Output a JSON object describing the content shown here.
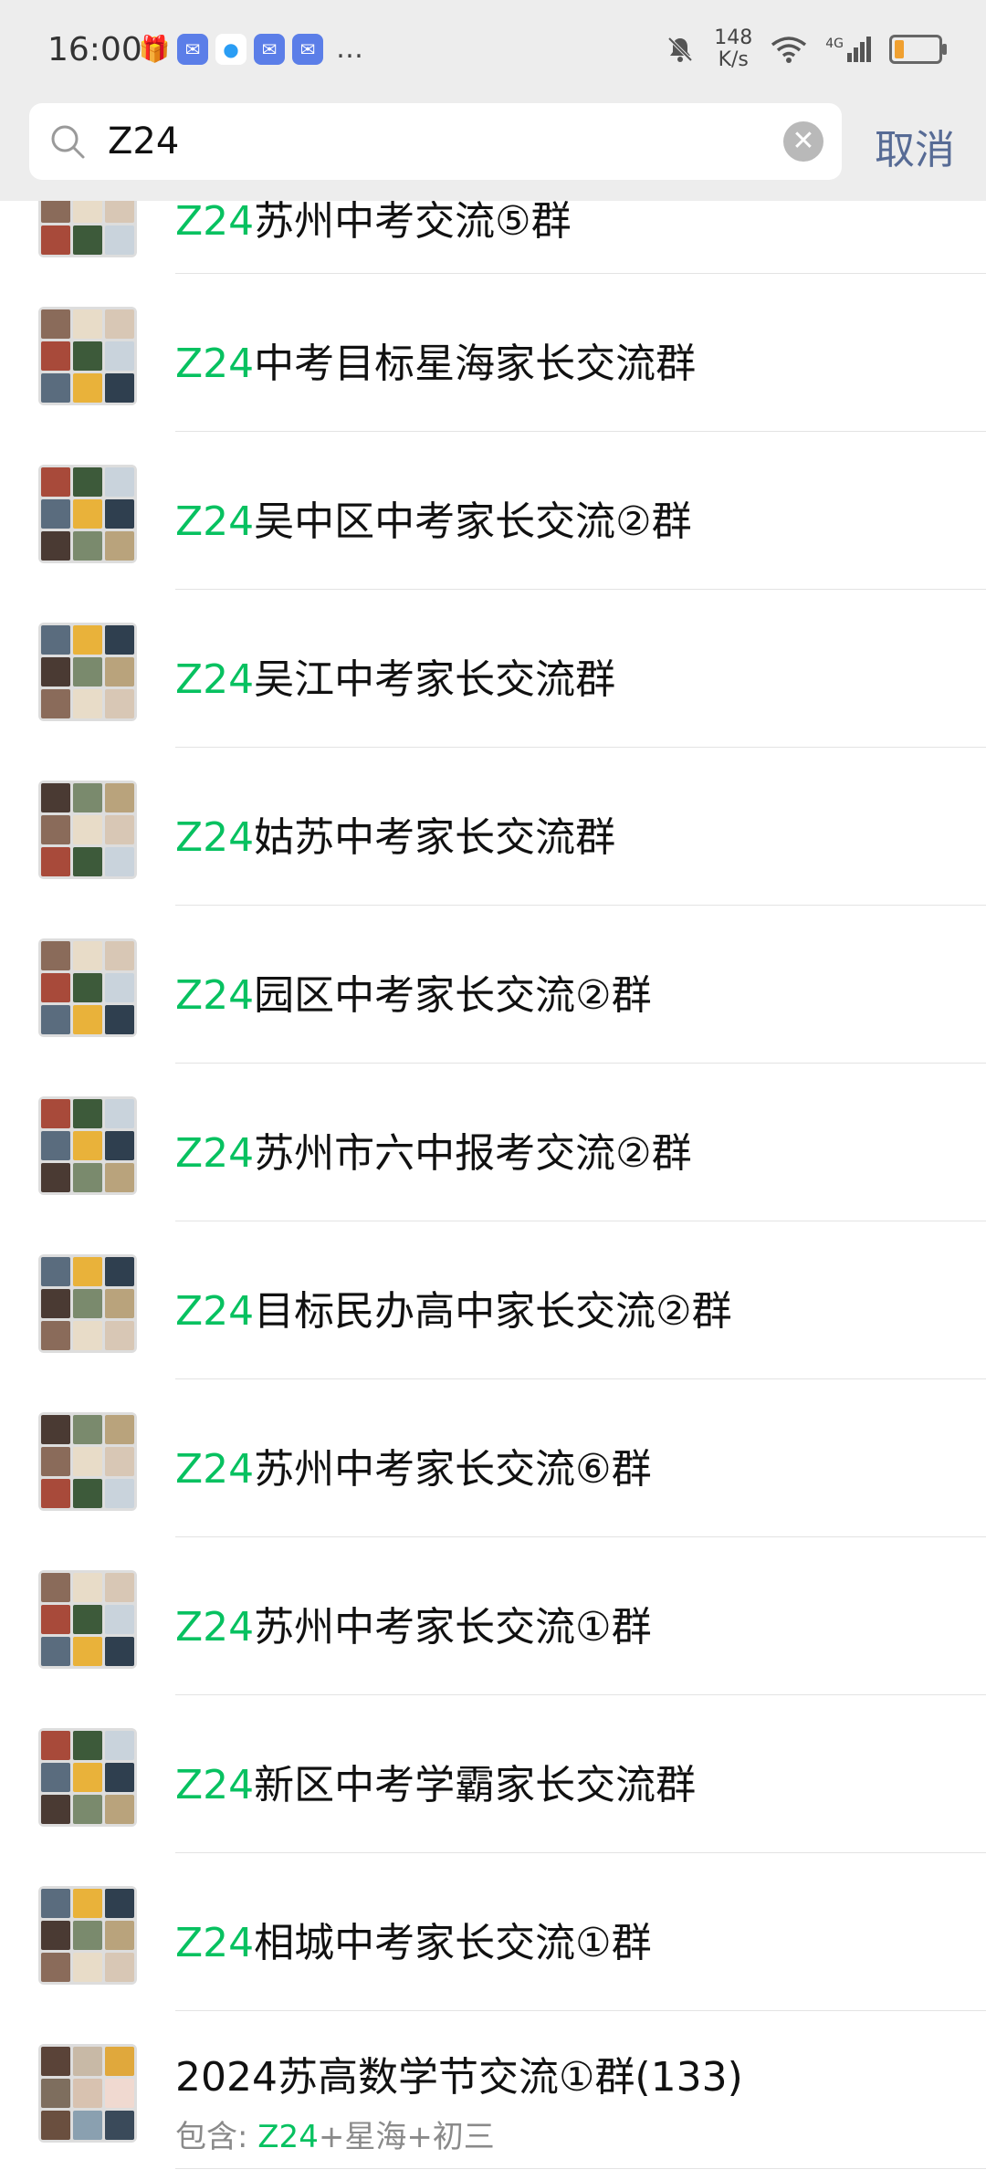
{
  "status_bar": {
    "time": "16:00",
    "net_speed_value": "148",
    "net_speed_unit": "K/s",
    "network": "4G",
    "battery_level": 0.22,
    "battery_color": "#f0a030"
  },
  "search": {
    "query": "Z24",
    "cancel_label": "取消"
  },
  "highlight_color": "#07c160",
  "results": [
    {
      "prefix": "Z24",
      "rest": "苏州中考交流⑤群"
    },
    {
      "prefix": "Z24",
      "rest": "中考目标星海家长交流群"
    },
    {
      "prefix": "Z24",
      "rest": "吴中区中考家长交流②群"
    },
    {
      "prefix": "Z24",
      "rest": "吴江中考家长交流群"
    },
    {
      "prefix": "Z24",
      "rest": "姑苏中考家长交流群"
    },
    {
      "prefix": "Z24",
      "rest": "园区中考家长交流②群"
    },
    {
      "prefix": "Z24",
      "rest": "苏州市六中报考交流②群"
    },
    {
      "prefix": "Z24",
      "rest": "目标民办高中家长交流②群"
    },
    {
      "prefix": "Z24",
      "rest": "苏州中考家长交流⑥群"
    },
    {
      "prefix": "Z24",
      "rest": "苏州中考家长交流①群"
    },
    {
      "prefix": "Z24",
      "rest": "新区中考学霸家长交流群"
    },
    {
      "prefix": "Z24",
      "rest": "相城中考家长交流①群"
    }
  ],
  "last_result": {
    "title": "2024苏高数学节交流①群(133)",
    "subtitle_label": "包含: ",
    "subtitle_match": "Z24",
    "subtitle_rest": "+星海+初三"
  }
}
